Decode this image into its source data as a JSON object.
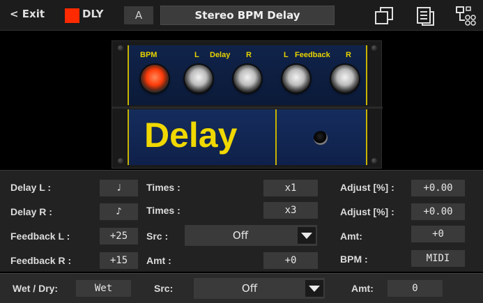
{
  "topbar": {
    "exit_label": "< Exit",
    "fx_slot_label": "DLY",
    "fx_slot_color": "#ff2a00",
    "variation_label": "A",
    "title": "Stereo BPM Delay",
    "icons": [
      "copy-icon",
      "list-icon",
      "routing-icon"
    ]
  },
  "panel": {
    "labels": {
      "bpm": "BPM",
      "delay_l": "L",
      "delay": "Delay",
      "delay_r": "R",
      "feedback_l": "L",
      "feedback": "Feedback",
      "feedback_r": "R"
    },
    "effect_name": "Delay",
    "accent_color": "#f0d800",
    "panel_color": "#10234a"
  },
  "params": {
    "delay_l": {
      "label": "Delay L :",
      "value": "♩"
    },
    "delay_r": {
      "label": "Delay R :",
      "value": "♪"
    },
    "feedback_l": {
      "label": "Feedback L :",
      "value": "+25"
    },
    "feedback_r": {
      "label": "Feedback R :",
      "value": "+15"
    },
    "times_1": {
      "label": "Times :",
      "value": "x1"
    },
    "times_2": {
      "label": "Times :",
      "value": "x3"
    },
    "src": {
      "label": "Src :",
      "value": "Off"
    },
    "amt_mid": {
      "label": "Amt :",
      "value": "+0"
    },
    "adjust_1": {
      "label": "Adjust [%] :",
      "value": "+0.00"
    },
    "adjust_2": {
      "label": "Adjust [%] :",
      "value": "+0.00"
    },
    "amt_right": {
      "label": "Amt:",
      "value": "+0"
    },
    "bpm": {
      "label": "BPM :",
      "value": "MIDI"
    }
  },
  "bottom": {
    "wetdry": {
      "label": "Wet / Dry:",
      "value": "Wet"
    },
    "src": {
      "label": "Src:",
      "value": "Off"
    },
    "amt": {
      "label": "Amt:",
      "value": "0"
    }
  }
}
